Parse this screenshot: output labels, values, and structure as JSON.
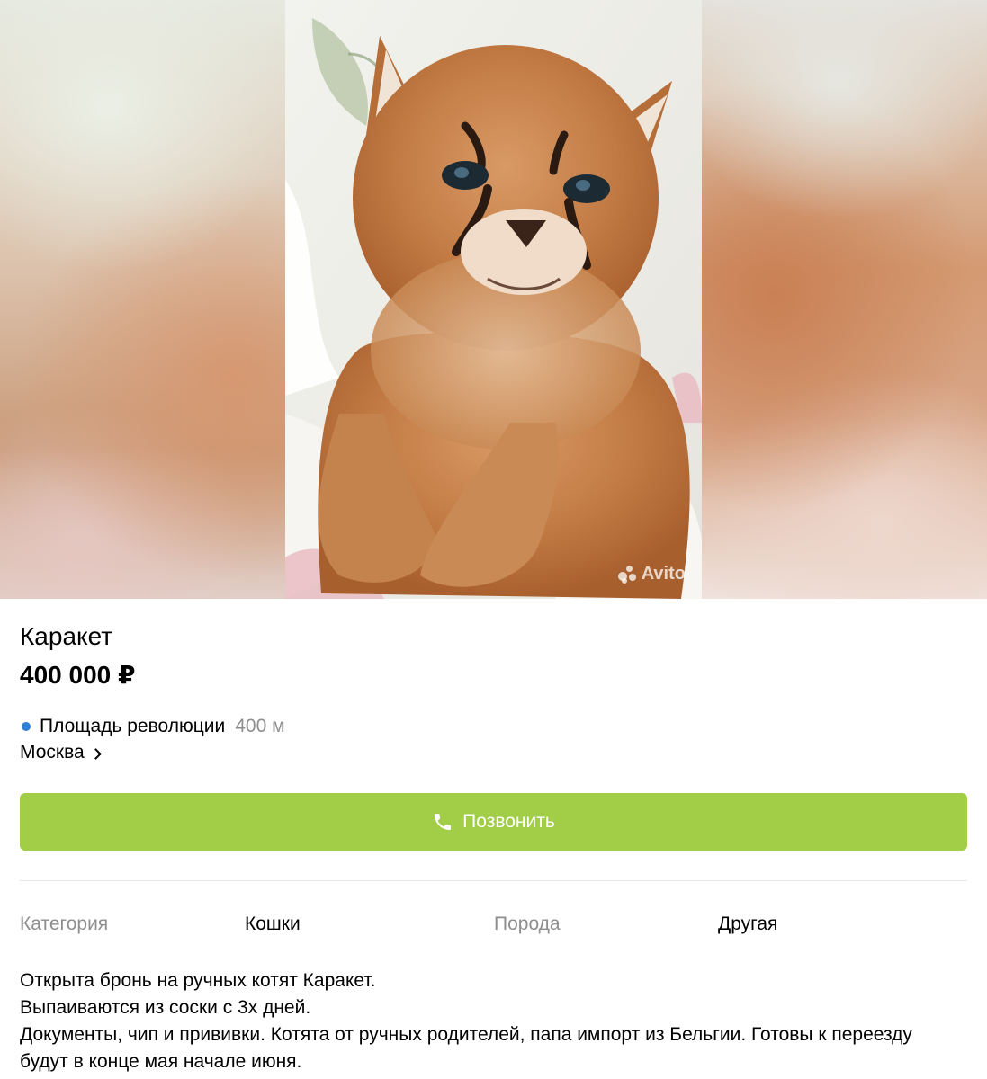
{
  "listing": {
    "title": "Каракет",
    "price": "400 000 ₽",
    "watermark": "Avito"
  },
  "location": {
    "metro_station": "Площадь революции",
    "metro_distance": "400 м",
    "metro_color": "#2f7fd6",
    "city": "Москва"
  },
  "actions": {
    "call_label": "Позвонить",
    "call_color": "#a1cd47"
  },
  "params": [
    {
      "key": "Категория",
      "value": "Кошки"
    },
    {
      "key": "Порода",
      "value": "Другая"
    }
  ],
  "description": [
    "Открыта бронь на ручных  котят Каракет.",
    "Выпаиваются из соски с 3х дней.",
    "Документы, чип и прививки. Котята от ручных родителей, папа импорт из Бельгии. Готовы к переезду",
    "будут в конце мая начале июня."
  ]
}
